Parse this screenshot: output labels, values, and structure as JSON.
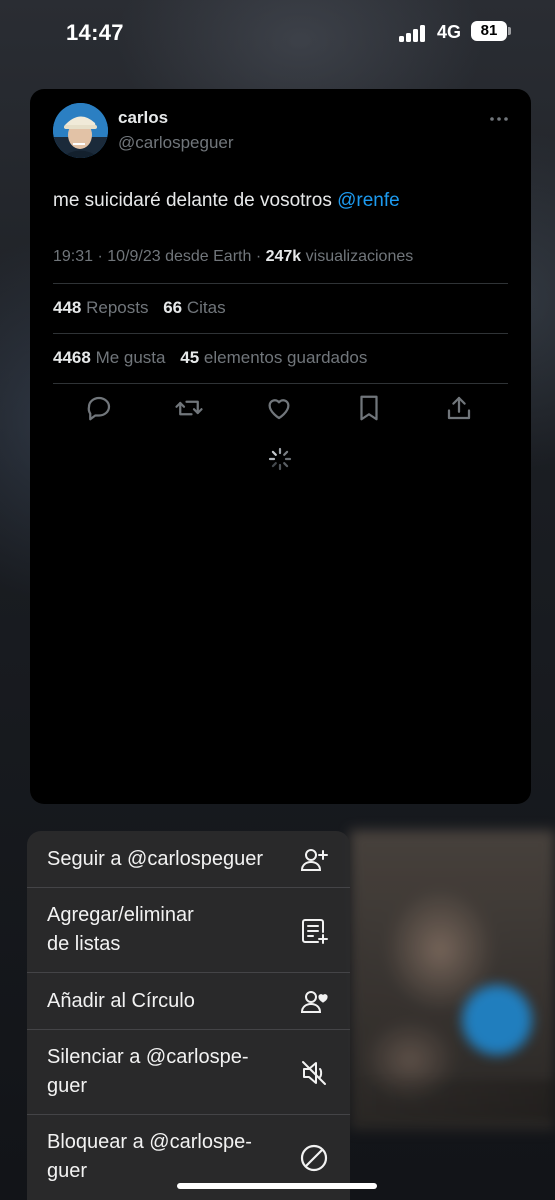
{
  "status_bar": {
    "time": "14:47",
    "network": "4G",
    "battery": "81"
  },
  "tweet": {
    "author_name": "carlos",
    "author_handle": "@carlospeguer",
    "text": "me suicidaré delante de vosotros",
    "mention": "@renfe",
    "meta_prefix": "19:31 · 10/9/23 desde Earth ·",
    "views_count": "247k",
    "views_label": "visualizaciones",
    "reposts_count": "448",
    "reposts_label": "Reposts",
    "quotes_count": "66",
    "quotes_label": "Citas",
    "likes_count": "4468",
    "likes_label": "Me gusta",
    "bookmarks_count": "45",
    "bookmarks_label": "elementos guardados",
    "actions": [
      "reply-icon",
      "repost-icon",
      "like-icon",
      "bookmark-icon",
      "share-icon"
    ]
  },
  "menu": {
    "items": [
      {
        "label": "Seguir a @carlospeguer",
        "icon": "follow-user-icon"
      },
      {
        "label": "Agregar/eliminar\nde listas",
        "icon": "list-add-icon"
      },
      {
        "label": "Añadir al Círculo",
        "icon": "circle-user-icon"
      },
      {
        "label": "Silenciar a @carlospe-\nguer",
        "icon": "mute-icon"
      },
      {
        "label": "Bloquear a @carlospe-\nguer",
        "icon": "block-icon"
      }
    ]
  },
  "colors": {
    "accent": "#1d9bf0",
    "card_bg": "#000000",
    "menu_bg": "#2a2a2c",
    "muted_text": "#71767b"
  }
}
